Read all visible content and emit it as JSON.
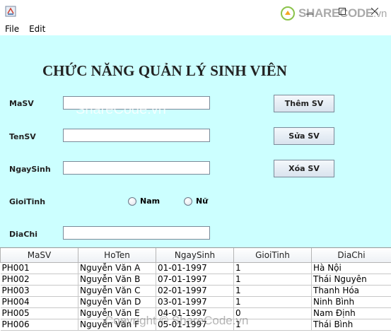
{
  "window": {
    "watermark_brand": "SHARECODE",
    "watermark_suffix": ".vn"
  },
  "menu": [
    "File",
    "Edit"
  ],
  "form": {
    "title": "CHỨC NĂNG QUẢN LÝ SINH VIÊN",
    "fields": [
      {
        "label": "MaSV",
        "value": ""
      },
      {
        "label": "TenSV",
        "value": ""
      },
      {
        "label": "NgaySinh",
        "value": ""
      },
      {
        "label": "GioiTinh"
      },
      {
        "label": "DiaChi",
        "value": ""
      }
    ],
    "gender_options": [
      "Nam",
      "Nữ"
    ],
    "buttons": {
      "add": "Thêm SV",
      "edit": "Sửa SV",
      "delete": "Xóa SV"
    },
    "overlay_watermark": "ShareCode.vn"
  },
  "table": {
    "columns": [
      "MaSV",
      "HoTen",
      "NgaySinh",
      "GioiTinh",
      "DiaChi"
    ],
    "rows": [
      [
        "PH001",
        "Nguyễn Văn A",
        "01-01-1997",
        "1",
        "Hà Nội"
      ],
      [
        "PH002",
        "Nguyễn Văn B",
        "07-01-1997",
        "1",
        "Thái Nguyên"
      ],
      [
        "PH003",
        "Nguyễn Văn C",
        "02-01-1997",
        "1",
        "Thanh Hóa"
      ],
      [
        "PH004",
        "Nguyễn Văn D",
        "03-01-1997",
        "1",
        "Ninh Bình"
      ],
      [
        "PH005",
        "Nguyễn Văn E",
        "04-01-1997",
        "0",
        "Nam Định"
      ],
      [
        "PH006",
        "Nguyễn Văn F",
        "05-01-1997",
        "1",
        "Thái Bình"
      ]
    ],
    "overlay_watermark": "Copyright © ShareCode.vn"
  },
  "colors": {
    "panel_bg": "#ccffff"
  }
}
